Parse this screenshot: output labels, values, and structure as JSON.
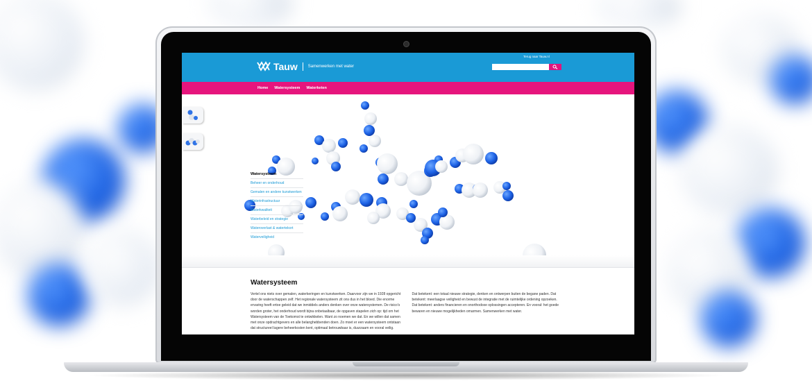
{
  "header": {
    "brand": "Tauw",
    "tagline": "Samenwerken met water",
    "back_link": "Terug naar Tauw.nl",
    "search_placeholder": ""
  },
  "nav": {
    "items": [
      {
        "label": "Home"
      },
      {
        "label": "Watersysteem"
      },
      {
        "label": "Waterketen"
      }
    ]
  },
  "submenu": {
    "title": "Watersysteem",
    "items": [
      {
        "label": "Beheer en onderhoud"
      },
      {
        "label": "Gemalen en andere kunstwerken"
      },
      {
        "label": "Waterinfrastructuur"
      },
      {
        "label": "Waterkwaliteit"
      },
      {
        "label": "Waterbeleid en strategie"
      },
      {
        "label": "Wateroverlast & watertekort"
      },
      {
        "label": "Waterveiligheid"
      }
    ]
  },
  "content": {
    "heading": "Watersysteem",
    "col1": "Vertel ons niets over gemalen, waterkeringen en kunstwerken. Daarvoor zijn we in 1928 opgericht door de waterschappen zelf. Het regionale watersysteem zit ons dus in het bloed. Die enorme ervaring heeft ertoe geleid dat we inmiddels anders denken over onze watersystemen. De risico's worden groter, het onderhoud wordt bijna onbetaalbaar, de opgaven stapelen zich op: tijd om het Watersysteem van de Toekomst te ontwikkelen. Want zo noemen we dat. En we willen dat samen met onze opdrachtgevers en alle belanghebbenden doen. Zo moet er een watersysteem ontstaan dat structureel lagere beheerkosten kent, optimaal betrouwbaar is, duurzaam en vooral veilig.",
    "col2": "Dat betekent: een totaal nieuwe strategie, denken en ontwerpen buiten de begane paden. Dat betekent: meerlaagse veiligheid en bewust de integratie met de ruimtelijke ordening opzoeken. Dat betekent: anders financieren en onorthodoxe oplossingen accepteren. En vooral: het goede bewaren en nieuwe mogelijkheden omarmen. Samenwerken met water."
  },
  "colors": {
    "header_blue": "#1a9ad6",
    "nav_pink": "#e6157d",
    "link_blue": "#1a9ad6"
  },
  "icons": [
    "tauw-logo-icon",
    "search-icon",
    "molecule-icon"
  ]
}
